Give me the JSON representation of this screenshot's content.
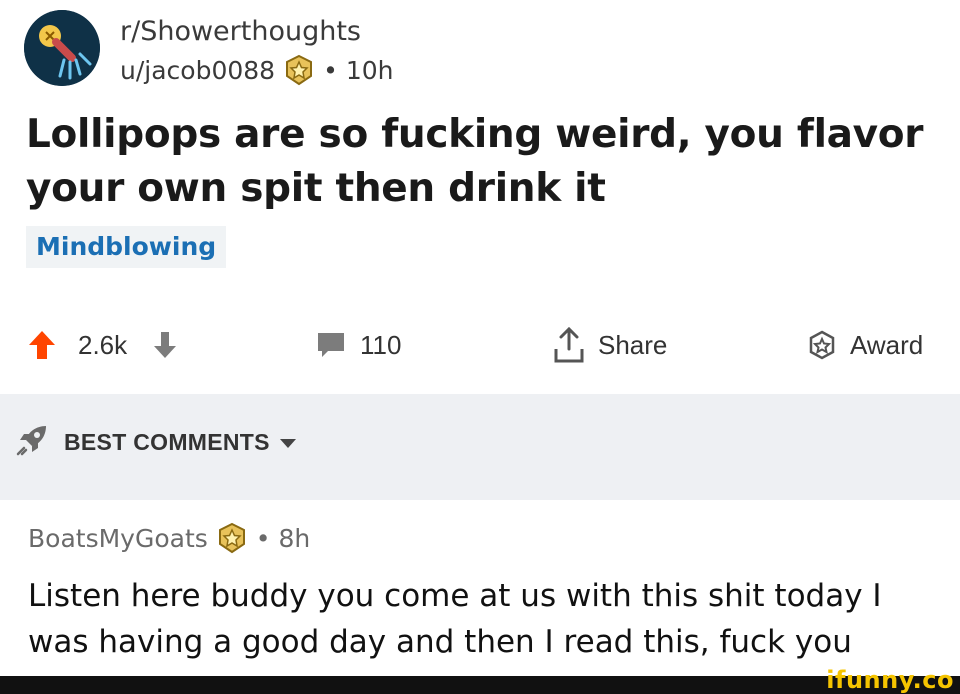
{
  "post": {
    "subreddit": "r/Showerthoughts",
    "author": "u/jacob0088",
    "age": "10h",
    "separator": "•",
    "title": "Lollipops are so fucking weird, you flavor your own spit then drink it",
    "flair": "Mindblowing"
  },
  "actions": {
    "score": "2.6k",
    "comments": "110",
    "share_label": "Share",
    "award_label": "Award",
    "upvote_color": "#ff4500"
  },
  "sort": {
    "label": "BEST COMMENTS"
  },
  "comment": {
    "author": "BoatsMyGoats",
    "age": "8h",
    "separator": "•",
    "body": "Listen here buddy you come at us with this shit today I was having a good day and then I read this, fuck you"
  },
  "watermark": "ifunny.co",
  "icons": [
    "subreddit-avatar-icon",
    "award-badge-icon",
    "upvote-icon",
    "downvote-icon",
    "comment-icon",
    "share-icon",
    "award-icon",
    "rocket-icon",
    "caret-down-icon"
  ]
}
